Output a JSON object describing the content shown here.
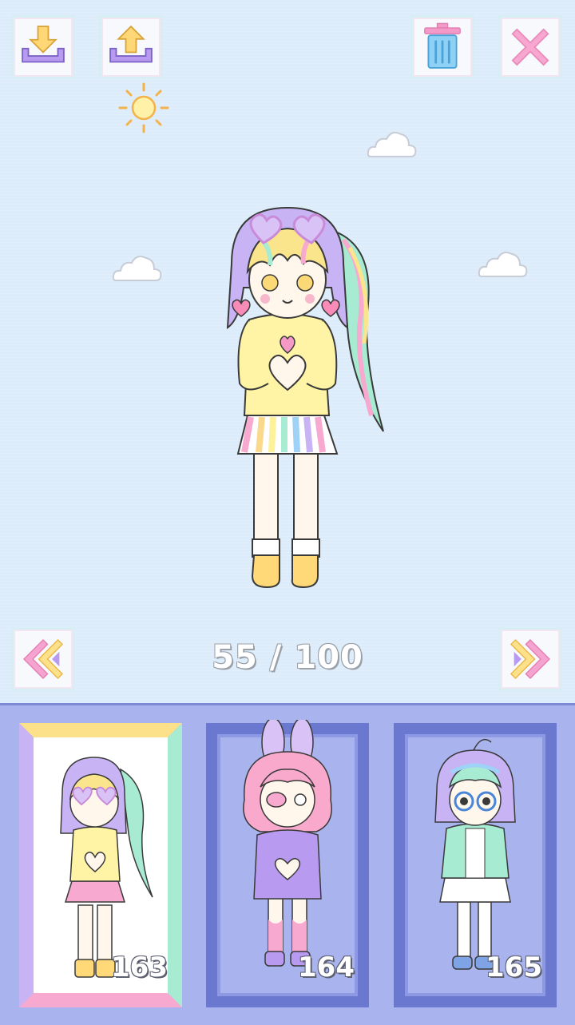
{
  "toolbar": {
    "download_icon": "download-icon",
    "upload_icon": "upload-icon",
    "trash_icon": "trash-icon",
    "close_icon": "close-icon"
  },
  "navigation": {
    "prev_icon": "double-chevron-left-icon",
    "next_icon": "double-chevron-right-icon",
    "current": 55,
    "total": 100,
    "counter_text": "55 / 100"
  },
  "slots": [
    {
      "number": "163",
      "selected": true
    },
    {
      "number": "164",
      "selected": false
    },
    {
      "number": "165",
      "selected": false
    }
  ],
  "colors": {
    "sky": "#dcecfa",
    "tray": "#a9b3ee",
    "slot_frame": "#6b78d0",
    "accent_pink": "#f49ac8",
    "accent_purple": "#b89af0"
  }
}
